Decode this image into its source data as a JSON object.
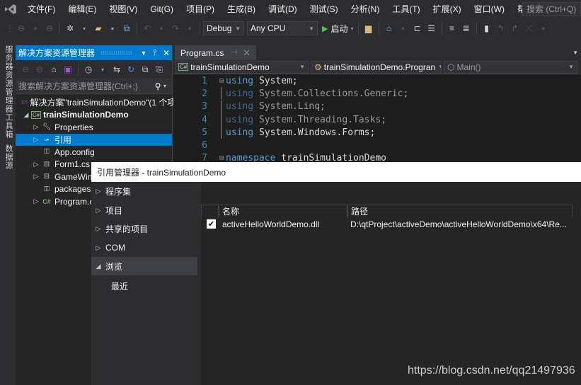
{
  "menubar": {
    "logo_icon": "visual-studio-logo-icon",
    "items": [
      "文件(F)",
      "编辑(E)",
      "视图(V)",
      "Git(G)",
      "项目(P)",
      "生成(B)",
      "调试(D)",
      "测试(S)",
      "分析(N)",
      "工具(T)",
      "扩展(X)",
      "窗口(W)",
      "帮助(H)"
    ],
    "search_placeholder": "搜索 (Ctrl+Q)"
  },
  "toolbar": {
    "configuration": "Debug",
    "platform": "Any CPU",
    "start_label": "启动",
    "accent_green": "#4ec94e"
  },
  "left_strip": {
    "tabs": [
      "服务器资源管理器",
      "工具箱",
      "数据源"
    ]
  },
  "solution_explorer": {
    "title": "解决方案资源管理器",
    "search_placeholder": "搜索解决方案资源管理器(Ctrl+;)",
    "nodes": [
      {
        "label": "解决方案\"trainSimulationDemo\"(1 个项",
        "icon": "solution-icon"
      },
      {
        "label": "trainSimulationDemo",
        "icon": "csharp-project-icon"
      },
      {
        "label": "Properties",
        "icon": "wrench-icon"
      },
      {
        "label": "引用",
        "icon": "references-icon"
      },
      {
        "label": "App.config",
        "icon": "config-file-icon"
      },
      {
        "label": "Form1.cs",
        "icon": "form-icon"
      },
      {
        "label": "GameWindow.cs",
        "icon": "form-icon"
      },
      {
        "label": "packages.config",
        "icon": "config-file-icon"
      },
      {
        "label": "Program.cs",
        "icon": "csharp-file-icon"
      }
    ],
    "accent": "#007acc"
  },
  "editor": {
    "tab_label": "Program.cs",
    "nav_project": "trainSimulationDemo",
    "nav_class": "trainSimulationDemo.Progran",
    "nav_member": "Main()",
    "lines": [
      {
        "n": "1",
        "kw": "using",
        "rest": " System;",
        "dim": false,
        "fold": "⊟"
      },
      {
        "n": "2",
        "kw": "using",
        "rest": " System.Collections.Generic;",
        "dim": true,
        "fold": ""
      },
      {
        "n": "3",
        "kw": "using",
        "rest": " System.Linq;",
        "dim": true,
        "fold": ""
      },
      {
        "n": "4",
        "kw": "using",
        "rest": " System.Threading.Tasks;",
        "dim": true,
        "fold": ""
      },
      {
        "n": "5",
        "kw": "using",
        "rest": " System.Windows.Forms;",
        "dim": false,
        "fold": ""
      },
      {
        "n": "6",
        "kw": "",
        "rest": "",
        "dim": false,
        "fold": ""
      },
      {
        "n": "7",
        "kw": "namespace",
        "rest": " trainSimulationDemo",
        "dim": false,
        "fold": "⊟"
      }
    ]
  },
  "reference_manager": {
    "title": "引用管理器 - trainSimulationDemo",
    "categories": [
      {
        "label": "程序集",
        "expanded": false
      },
      {
        "label": "项目",
        "expanded": false
      },
      {
        "label": "共享的项目",
        "expanded": false
      },
      {
        "label": "COM",
        "expanded": false
      },
      {
        "label": "浏览",
        "expanded": true
      }
    ],
    "sub_items": [
      "最近"
    ],
    "columns": [
      "名称",
      "路径"
    ],
    "rows": [
      {
        "checked": true,
        "name": "activeHelloWorldDemo.dll",
        "path": "D:\\qtProject\\activeDemo\\activeHelloWorldDemo\\x64\\Re..."
      }
    ]
  },
  "watermark": "https://blog.csdn.net/qq21497936"
}
